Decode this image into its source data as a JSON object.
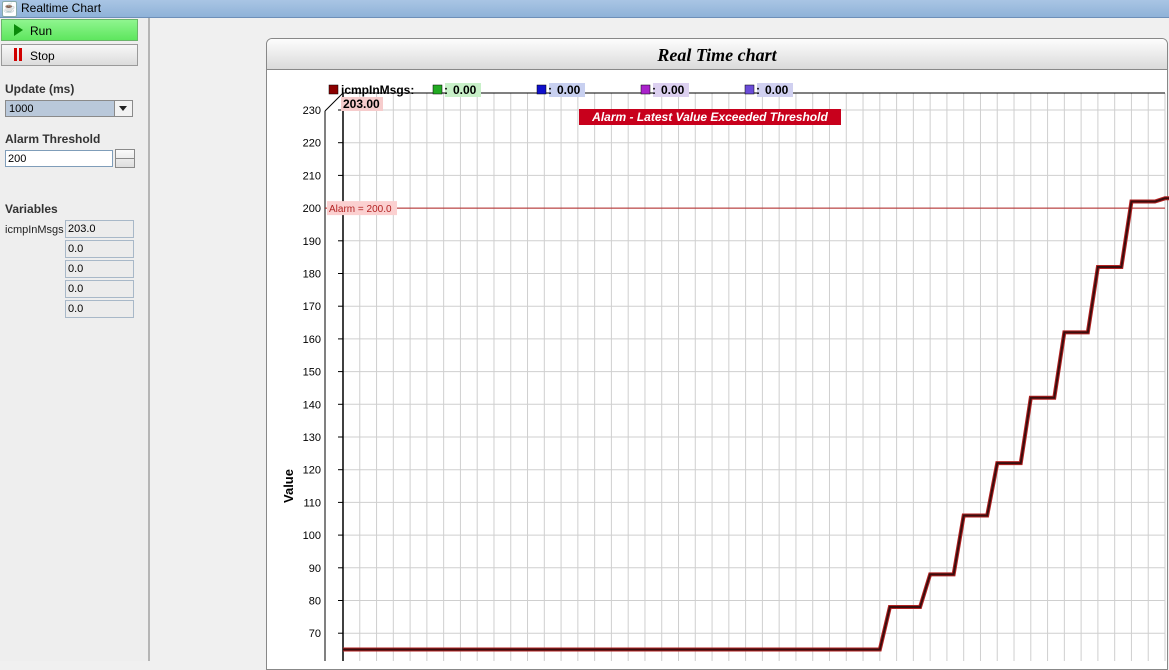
{
  "window": {
    "title": "Realtime Chart"
  },
  "controls": {
    "run_label": "Run",
    "stop_label": "Stop",
    "update_label": "Update (ms)",
    "update_value": "1000",
    "alarm_label": "Alarm Threshold",
    "alarm_value": "200",
    "variables_label": "Variables",
    "variables": [
      {
        "name": "icmpInMsgs",
        "value": "203.0"
      },
      {
        "name": "",
        "value": "0.0"
      },
      {
        "name": "",
        "value": "0.0"
      },
      {
        "name": "",
        "value": "0.0"
      },
      {
        "name": "",
        "value": "0.0"
      }
    ]
  },
  "chart_data": {
    "type": "line",
    "title": "Real Time chart",
    "ylabel": "Value",
    "xlabel": "",
    "ylim": [
      65,
      230
    ],
    "yticks": [
      230,
      220,
      210,
      200,
      190,
      180,
      170,
      160,
      150,
      140,
      130,
      120,
      110,
      100,
      90,
      80,
      70
    ],
    "grid": true,
    "legend_position": "top",
    "legend": [
      {
        "name": "icmpInMsgs:",
        "value": "203.00",
        "color": "#8b0000"
      },
      {
        "name": "",
        "value": "0.00",
        "color": "#22aa22"
      },
      {
        "name": "",
        "value": "0.00",
        "color": "#1010cc"
      },
      {
        "name": "",
        "value": "0.00",
        "color": "#aa22cc"
      },
      {
        "name": "",
        "value": "0.00",
        "color": "#6a4cd8"
      }
    ],
    "legend_bg": [
      "#f6cccc",
      "#c8f0c8",
      "#c8d0f0",
      "#dcd0f0",
      "#d0d0f0"
    ],
    "alarm": {
      "value": 200,
      "label": "Alarm = 200.0",
      "color": "#b22222"
    },
    "alarm_banner": "Alarm - Latest Value Exceeded Threshold",
    "series": [
      {
        "name": "icmpInMsgs",
        "color": "#3a0d0d",
        "x": [
          0,
          32,
          32.6,
          34.4,
          35,
          36.4,
          37,
          38.4,
          39,
          40.4,
          41,
          42.4,
          43,
          44.4,
          45,
          46.4,
          47,
          48.4,
          49,
          51
        ],
        "y": [
          65,
          65,
          78,
          78,
          88,
          88,
          106,
          106,
          122,
          122,
          142,
          142,
          162,
          162,
          182,
          182,
          202,
          202,
          203,
          203
        ]
      }
    ],
    "xlim": [
      0,
      49
    ]
  }
}
